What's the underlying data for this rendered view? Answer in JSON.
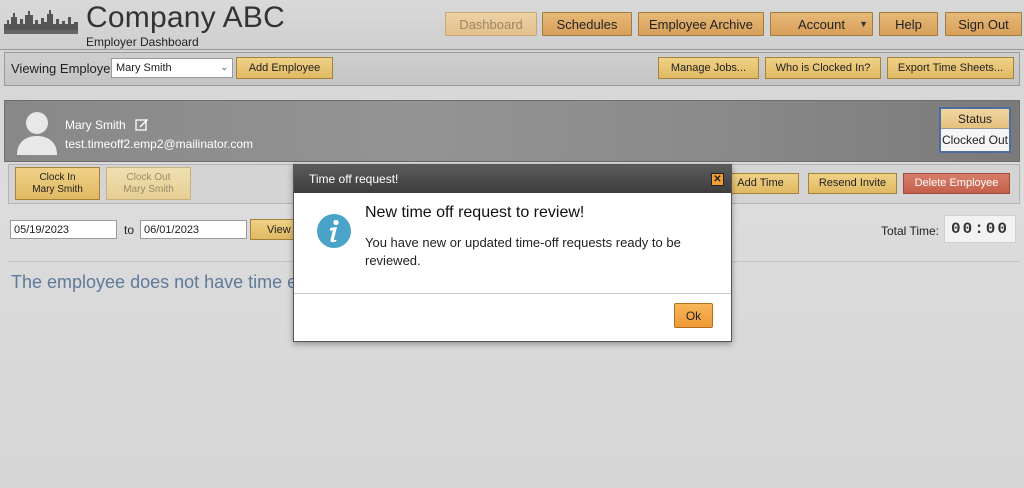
{
  "header": {
    "company_name": "Company ABC",
    "subtitle": "Employer Dashboard",
    "nav": [
      {
        "label": "Dashboard",
        "disabled": true
      },
      {
        "label": "Schedules"
      },
      {
        "label": "Employee Archive"
      },
      {
        "label": "Account"
      },
      {
        "label": "Help"
      },
      {
        "label": "Sign Out"
      }
    ]
  },
  "toolbar": {
    "viewing_label": "Viewing Employee:",
    "selected_employee": "Mary Smith",
    "add_employee": "Add Employee",
    "manage_jobs": "Manage Jobs...",
    "who_clocked_in": "Who is Clocked In?",
    "export_time_sheets": "Export Time Sheets..."
  },
  "employee": {
    "name": "Mary Smith",
    "email": "test.timeoff2.emp2@mailinator.com",
    "status_label": "Status",
    "status_value": "Clocked Out"
  },
  "actions": {
    "clock_in_line1": "Clock In",
    "clock_in_line2": "Mary Smith",
    "clock_out_line1": "Clock Out",
    "clock_out_line2": "Mary Smith",
    "add_time": "Add Time",
    "resend_invite": "Resend Invite",
    "delete_employee": "Delete Employee"
  },
  "date_range": {
    "from": "05/19/2023",
    "to_label": "to",
    "to": "06/01/2023",
    "view_button": "View I",
    "total_label": "Total Time:",
    "total_value": "00:00"
  },
  "content": {
    "no_entries": "The employee does not have time entries"
  },
  "modal": {
    "title": "Time off request!",
    "heading": "New time off request to review!",
    "body": "You have new or updated time-off requests ready to be reviewed.",
    "ok": "Ok"
  },
  "colors": {
    "nav_button": "#e0ac68",
    "toolbar_button": "#e8c572",
    "danger_button": "#cc6a55",
    "modal_title_bar": "#4a4a4a",
    "info_icon": "#4aa3c9",
    "ok_button": "#f3a746"
  }
}
